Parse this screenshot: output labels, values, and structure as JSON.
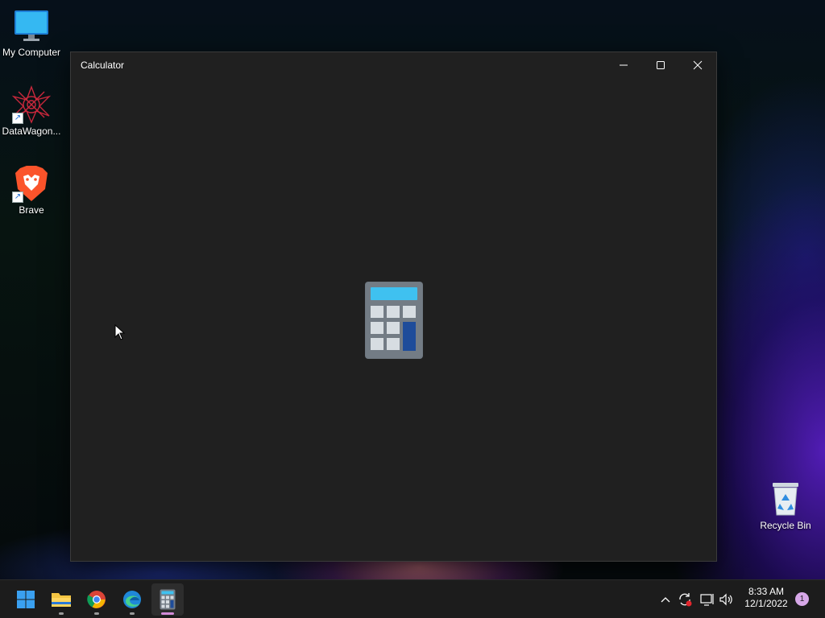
{
  "desktop": {
    "icons": [
      {
        "label": "My Computer"
      },
      {
        "label": "DataWagon..."
      },
      {
        "label": "Brave"
      },
      {
        "label": "Recycle Bin"
      }
    ]
  },
  "window": {
    "title": "Calculator",
    "controls": {
      "minimize": "minimize-icon",
      "maximize": "maximize-icon",
      "close": "close-icon"
    },
    "splash_icon": "calculator-icon"
  },
  "taskbar": {
    "apps": [
      {
        "name": "start-button",
        "icon": "windows-logo-icon"
      },
      {
        "name": "file-explorer",
        "icon": "folder-icon"
      },
      {
        "name": "google-chrome",
        "icon": "chrome-icon"
      },
      {
        "name": "microsoft-edge",
        "icon": "edge-icon"
      },
      {
        "name": "calculator",
        "icon": "calculator-icon",
        "active": true
      }
    ],
    "tray": {
      "icons": [
        "chevron-up-icon",
        "sync-icon",
        "network-icon",
        "volume-icon"
      ],
      "time": "8:33 AM",
      "date": "12/1/2022",
      "notification_count": "1"
    }
  },
  "colors": {
    "window_bg": "#202020",
    "taskbar_bg": "#1c1c1c",
    "active_indicator": "#d48bd8",
    "calc_screen": "#3fc1f0",
    "calc_key_accent": "#1e4c9a"
  }
}
